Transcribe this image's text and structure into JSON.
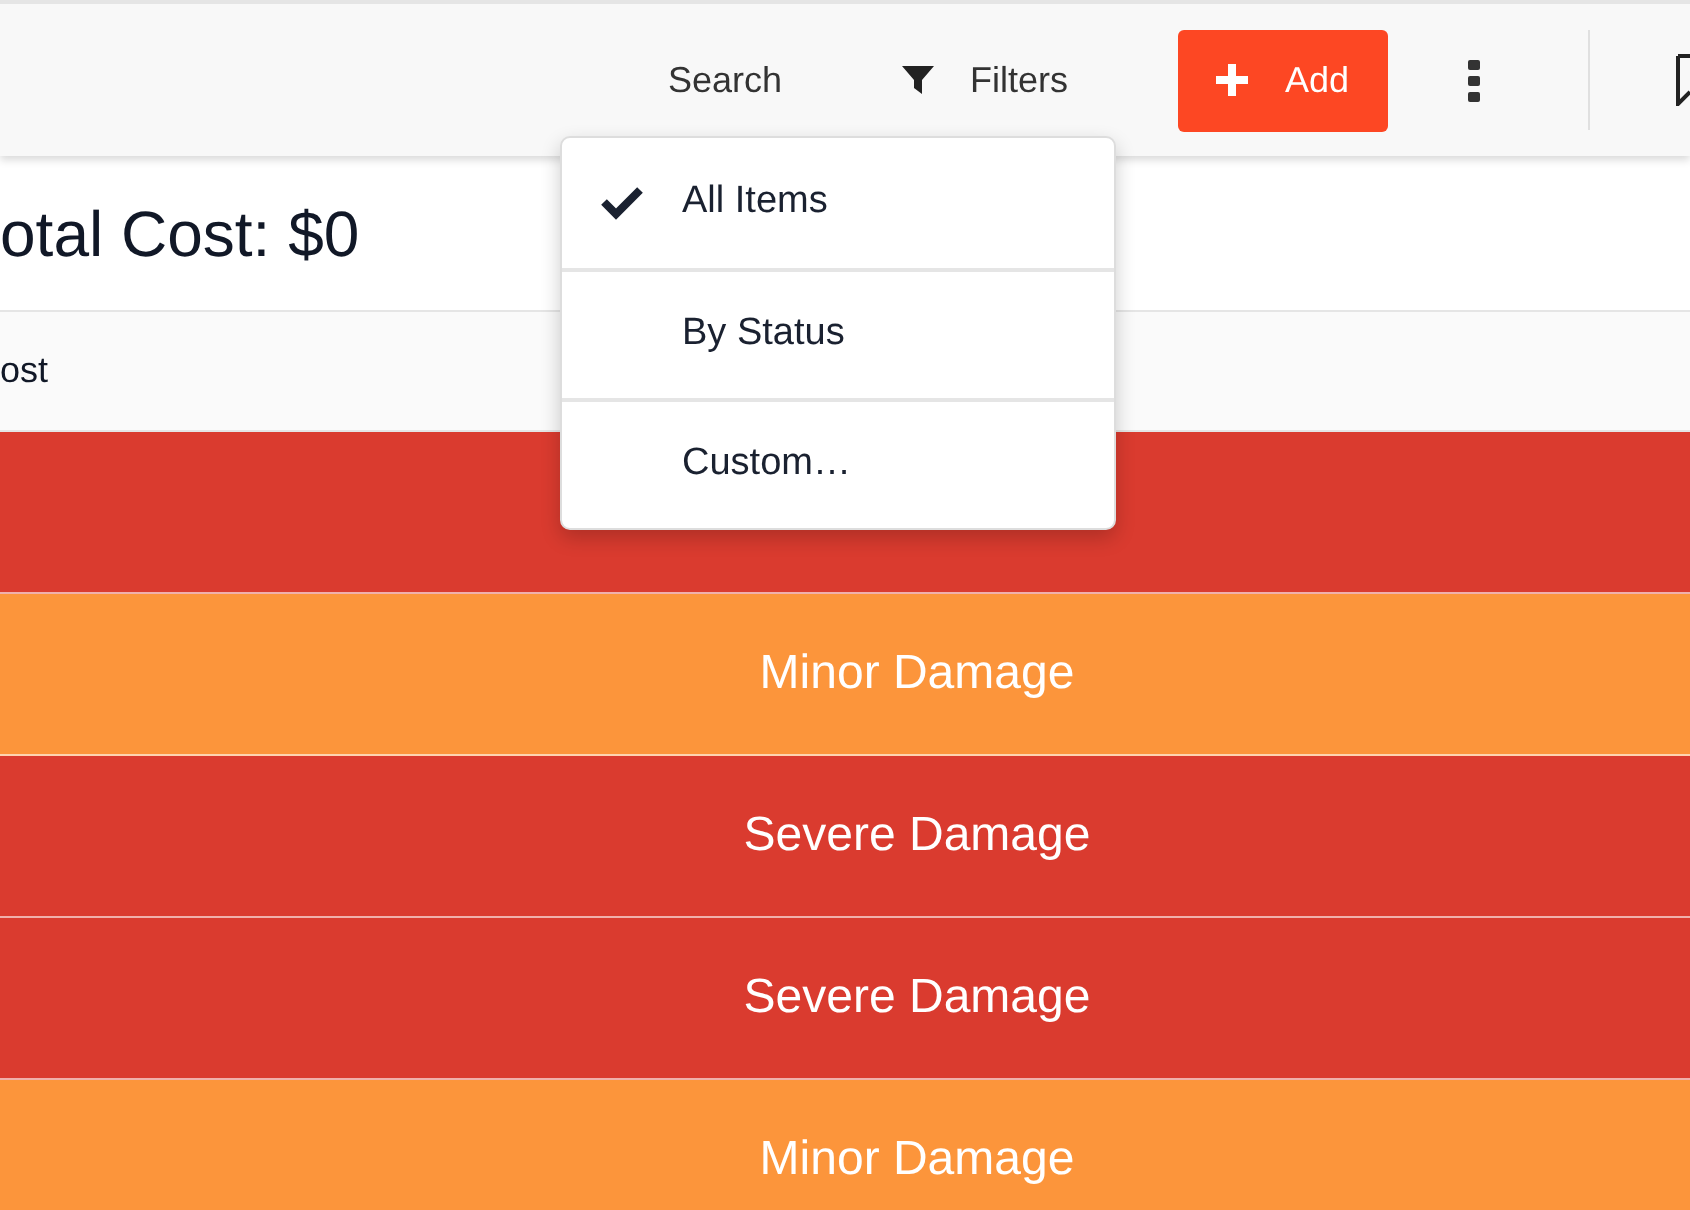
{
  "toolbar": {
    "search": "Search",
    "filters": "Filters",
    "add": "Add"
  },
  "total": "otal Cost: $0",
  "table": {
    "columns": [
      "ost"
    ],
    "rows": [
      {
        "color": "#da3b2f"
      },
      {
        "status": "Minor Damage",
        "color": "#fc953b"
      },
      {
        "status": "Severe Damage",
        "color": "#da3b2f"
      },
      {
        "status": "Severe Damage",
        "color": "#da3b2f"
      },
      {
        "status": "Minor Damage",
        "color": "#fc953b"
      }
    ]
  },
  "filter_menu": [
    {
      "label": "All Items",
      "selected": true
    },
    {
      "label": "By Status",
      "selected": false
    },
    {
      "label": "Custom…",
      "selected": false
    }
  ]
}
